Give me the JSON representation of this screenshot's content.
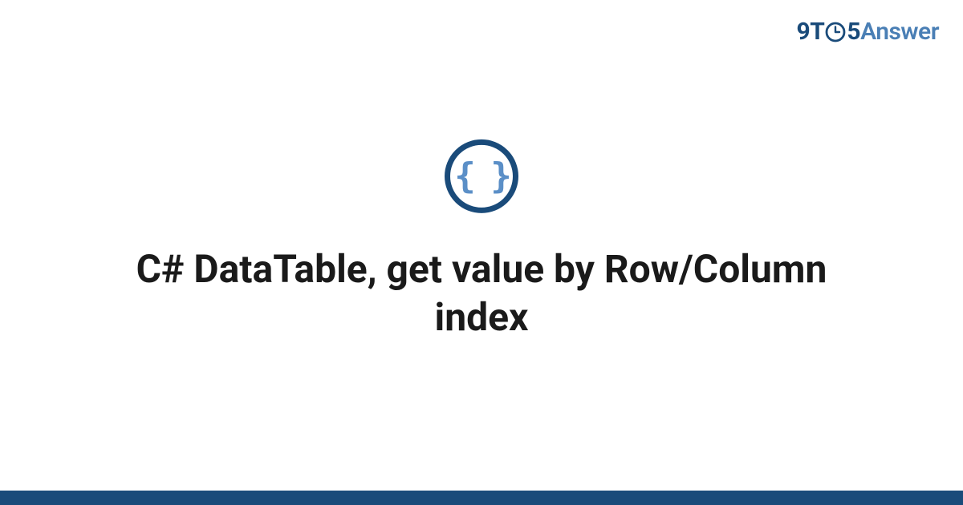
{
  "brand": {
    "part1": "9T",
    "part2": "5",
    "part3": "Answer"
  },
  "badge": {
    "glyph": "{ }"
  },
  "title": "C# DataTable, get value by Row/Column index",
  "colors": {
    "primary": "#1a4b7a",
    "secondary": "#4a7fb5",
    "badge_glyph": "#5b8fc7"
  }
}
